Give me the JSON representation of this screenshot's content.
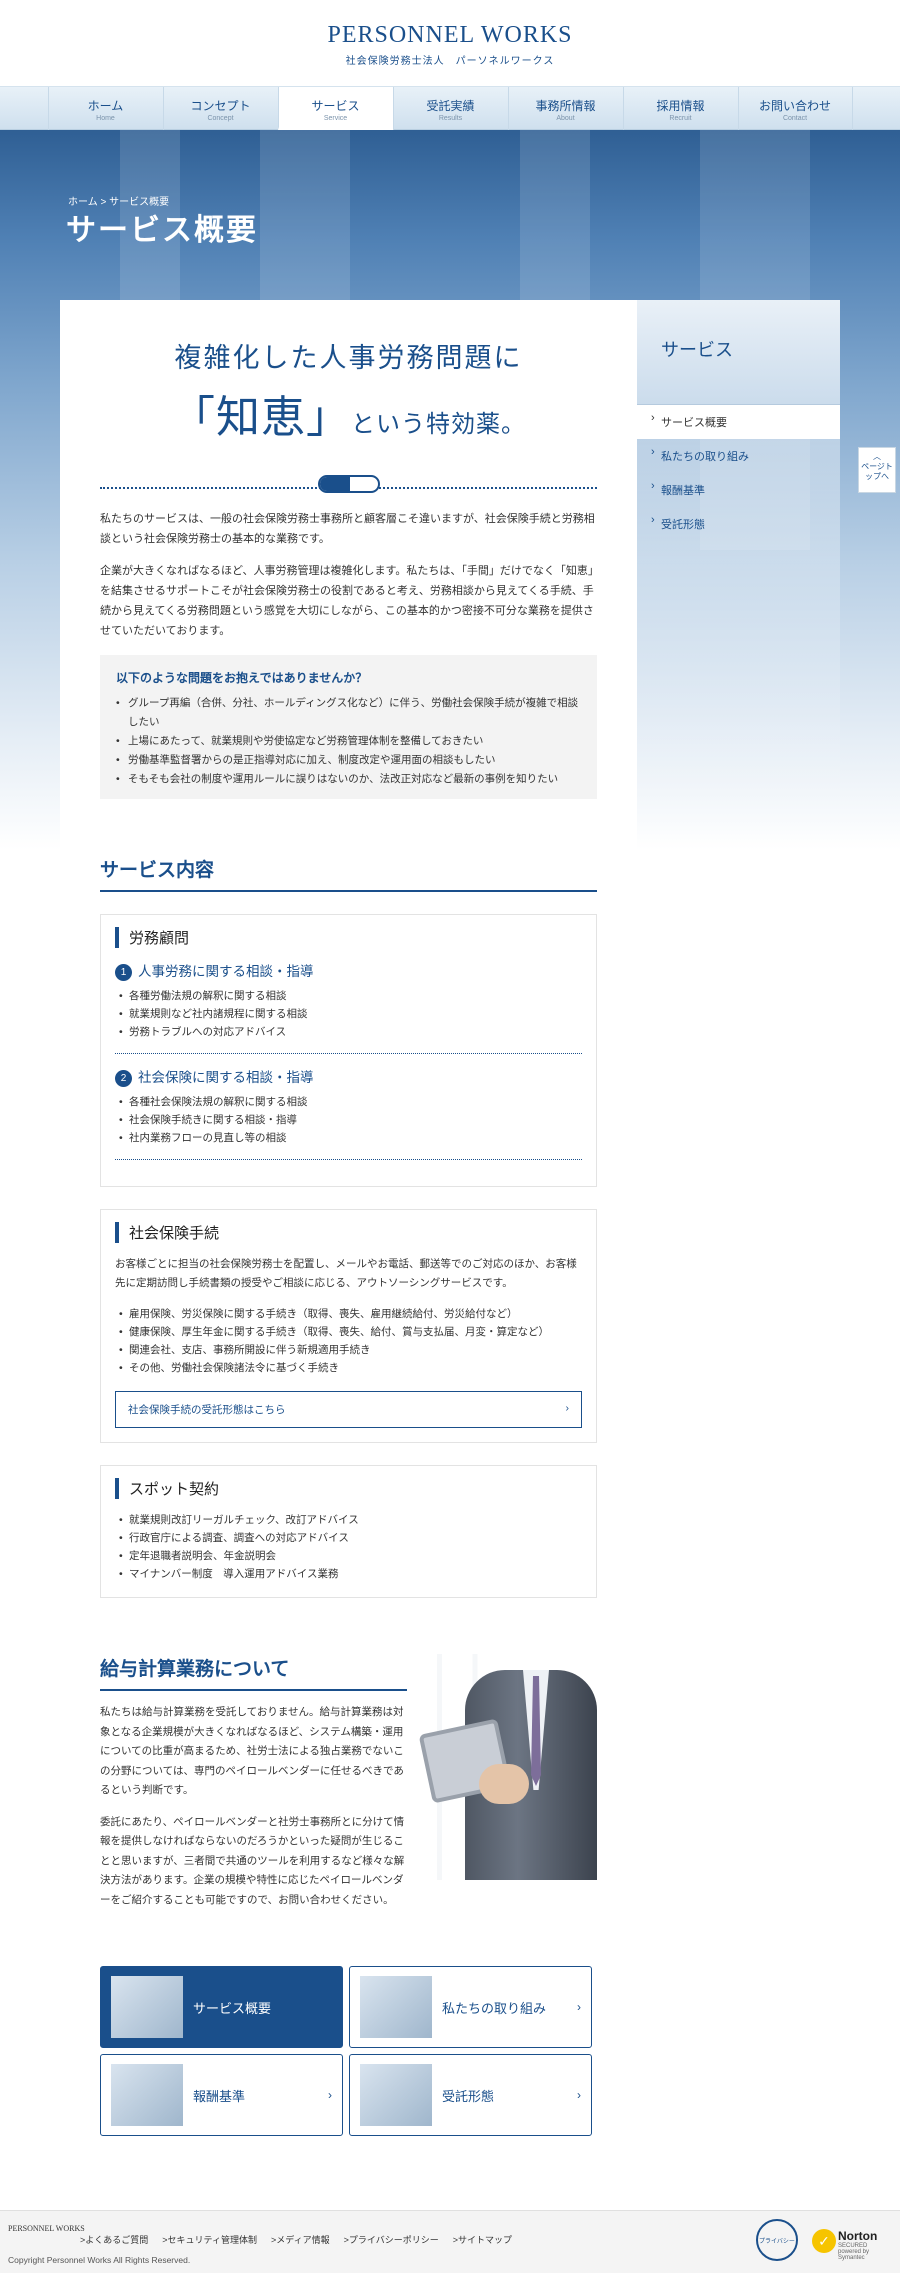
{
  "header": {
    "logo": "PERSONNEL WORKS",
    "logo_sub": "社会保険労務士法人　パーソネルワークス"
  },
  "nav": [
    {
      "ja": "ホーム",
      "en": "Home"
    },
    {
      "ja": "コンセプト",
      "en": "Concept"
    },
    {
      "ja": "サービス",
      "en": "Service"
    },
    {
      "ja": "受託実績",
      "en": "Results"
    },
    {
      "ja": "事務所情報",
      "en": "About"
    },
    {
      "ja": "採用情報",
      "en": "Recruit"
    },
    {
      "ja": "お問い合わせ",
      "en": "Contact"
    }
  ],
  "breadcrumb": "ホーム > サービス概要",
  "page_title": "サービス概要",
  "catch": {
    "line1": "複雑化した人事労務問題に",
    "big": "「知恵」",
    "small": "という特効薬。"
  },
  "intro": [
    "私たちのサービスは、一般の社会保険労務士事務所と顧客層こそ違いますが、社会保険手続と労務相談という社会保険労務士の基本的な業務です。",
    "企業が大きくなればなるほど、人事労務管理は複雑化します。私たちは、「手間」だけでなく「知恵」を結集させるサポートこそが社会保険労務士の役割であると考え、労務相談から見えてくる手続、手続から見えてくる労務問題という感覚を大切にしながら、この基本的かつ密接不可分な業務を提供させていただいております。"
  ],
  "question": {
    "title": "以下のような問題をお抱えではありませんか？",
    "items": [
      "グループ再編（合併、分社、ホールディングス化など）に伴う、労働社会保険手続が複雑で相談したい",
      "上場にあたって、就業規則や労使協定など労務管理体制を整備しておきたい",
      "労働基準監督署からの是正指導対応に加え、制度改定や運用面の相談もしたい",
      "そもそも会社の制度や運用ルールに誤りはないのか、法改正対応など最新の事例を知りたい"
    ]
  },
  "services": {
    "title": "サービス内容",
    "roumu": {
      "title": "労務顧問",
      "sub1": {
        "num": "1",
        "title": "人事労務に関する相談・指導",
        "items": [
          "各種労働法規の解釈に関する相談",
          "就業規則など社内諸規程に関する相談",
          "労務トラブルへの対応アドバイス"
        ]
      },
      "sub2": {
        "num": "2",
        "title": "社会保険に関する相談・指導",
        "items": [
          "各種社会保険法規の解釈に関する相談",
          "社会保険手続きに関する相談・指導",
          "社内業務フローの見直し等の相談"
        ]
      }
    },
    "shakai": {
      "title": "社会保険手続",
      "text": "お客様ごとに担当の社会保険労務士を配置し、メールやお電話、郵送等でのご対応のほか、お客様先に定期訪問し手続書類の授受やご相談に応じる、アウトソーシングサービスです。",
      "items": [
        "雇用保険、労災保険に関する手続き（取得、喪失、雇用継続給付、労災給付など）",
        "健康保険、厚生年金に関する手続き（取得、喪失、給付、賞与支払届、月変・算定など）",
        "関連会社、支店、事務所開設に伴う新規適用手続き",
        "その他、労働社会保険諸法令に基づく手続き"
      ],
      "link": "社会保険手続の受託形態はこちら"
    },
    "spot": {
      "title": "スポット契約",
      "items": [
        "就業規則改訂リーガルチェック、改訂アドバイス",
        "行政官庁による調査、調査への対応アドバイス",
        "定年退職者説明会、年金説明会",
        "マイナンバー制度　導入運用アドバイス業務"
      ]
    }
  },
  "kyuyo": {
    "title": "給与計算業務について",
    "p1": "私たちは給与計算業務を受託しておりません。給与計算業務は対象となる企業規模が大きくなればなるほど、システム構築・運用についての比重が高まるため、社労士法による独占業務でないこの分野については、専門のペイロールベンダーに任せるべきであるという判断です。",
    "p2": "委託にあたり、ペイロールベンダーと社労士事務所とに分けて情報を提供しなければならないのだろうかといった疑問が生じることと思いますが、三者間で共通のツールを利用するなど様々な解決方法があります。企業の規模や特性に応じたペイロールベンダーをご紹介することも可能ですので、お問い合わせください。"
  },
  "tiles": [
    "サービス概要",
    "私たちの取り組み",
    "報酬基準",
    "受託形態"
  ],
  "side": {
    "title": "サービス",
    "items": [
      "サービス概要",
      "私たちの取り組み",
      "報酬基準",
      "受託形態"
    ]
  },
  "pagetop": "ページトップへ",
  "footer": {
    "logo": "PERSONNEL WORKS",
    "links": [
      ">よくあるご質問",
      ">セキュリティ管理体制",
      ">メディア情報",
      ">プライバシーポリシー",
      ">サイトマップ"
    ],
    "copyright": "Copyright Personnel Works All Rights Reserved.",
    "badge1": "プライバシー",
    "badge2": "Norton",
    "badge2_sub": "SECURED",
    "badge2_by": "powered by Symantec"
  },
  "colors": {
    "brand": "#1a4f8b"
  }
}
